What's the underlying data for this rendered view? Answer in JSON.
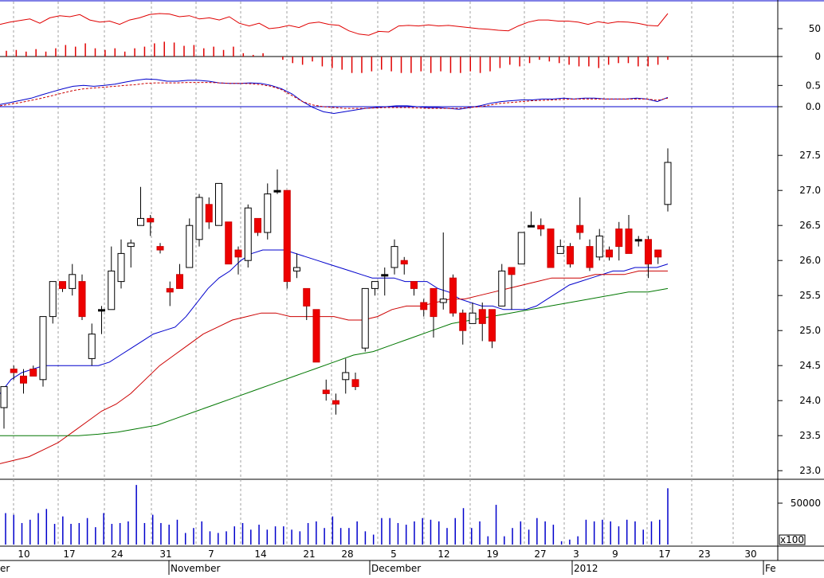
{
  "chart_data": [
    {
      "panel": "rsi",
      "type": "line",
      "y_range": [
        0,
        100
      ],
      "y_ticks": [
        "50"
      ],
      "series": [
        {
          "color": "#e00000",
          "values": [
            58,
            62,
            65,
            68,
            60,
            70,
            74,
            72,
            76,
            66,
            62,
            64,
            58,
            66,
            70,
            76,
            78,
            77,
            72,
            74,
            68,
            70,
            66,
            72,
            60,
            55,
            60,
            50,
            52,
            56,
            52,
            60,
            62,
            58,
            56,
            46,
            40,
            38,
            45,
            44,
            55,
            56,
            55,
            57,
            55,
            56,
            54,
            52,
            50,
            49,
            47,
            46,
            55,
            62,
            66,
            66,
            64,
            64,
            62,
            58,
            63,
            60,
            63,
            62,
            60,
            56,
            55,
            78
          ]
        }
      ]
    },
    {
      "panel": "rsi-histogram",
      "type": "bar",
      "y_range": [
        -30,
        30
      ],
      "y_ticks": [
        "0"
      ],
      "series": [
        {
          "color": "#e00000",
          "values": [
            7,
            8,
            6,
            9,
            6,
            10,
            14,
            12,
            16,
            10,
            8,
            10,
            6,
            10,
            12,
            16,
            18,
            17,
            13,
            14,
            10,
            12,
            8,
            12,
            4,
            2,
            4,
            0,
            -4,
            -8,
            -10,
            -6,
            -12,
            -14,
            -16,
            -20,
            -20,
            -18,
            -16,
            -18,
            -20,
            -20,
            -18,
            -20,
            -18,
            -20,
            -20,
            -18,
            -20,
            -18,
            -14,
            -10,
            -12,
            -8,
            -4,
            -6,
            -8,
            -10,
            -12,
            -12,
            -14,
            -10,
            -8,
            -8,
            -12,
            -12,
            -10,
            -4
          ]
        }
      ]
    },
    {
      "panel": "macd",
      "type": "line",
      "y_range": [
        -0.3,
        0.9
      ],
      "y_ticks": [
        "0.5",
        "0.0"
      ],
      "series": [
        {
          "color": "#0000cc",
          "values": [
            0.05,
            0.1,
            0.15,
            0.2,
            0.28,
            0.35,
            0.42,
            0.48,
            0.5,
            0.48,
            0.5,
            0.53,
            0.58,
            0.62,
            0.65,
            0.64,
            0.6,
            0.6,
            0.62,
            0.62,
            0.6,
            0.56,
            0.55,
            0.55,
            0.56,
            0.55,
            0.5,
            0.42,
            0.3,
            0.12,
            -0.02,
            -0.12,
            -0.16,
            -0.12,
            -0.08,
            -0.04,
            -0.02,
            0.0,
            0.02,
            0.02,
            0.0,
            -0.02,
            -0.02,
            -0.04,
            -0.06,
            -0.02,
            0.02,
            0.08,
            0.12,
            0.14,
            0.16,
            0.16,
            0.18,
            0.18,
            0.2,
            0.18,
            0.2,
            0.2,
            0.18,
            0.18,
            0.18,
            0.2,
            0.18,
            0.12,
            0.22
          ]
        },
        {
          "color": "#cc0000",
          "values": [
            0.02,
            0.06,
            0.1,
            0.15,
            0.2,
            0.26,
            0.32,
            0.38,
            0.42,
            0.44,
            0.46,
            0.48,
            0.5,
            0.52,
            0.55,
            0.56,
            0.56,
            0.56,
            0.57,
            0.57,
            0.57,
            0.56,
            0.55,
            0.55,
            0.54,
            0.52,
            0.48,
            0.4,
            0.26,
            0.12,
            0.04,
            0.0,
            -0.02,
            -0.04,
            -0.04,
            -0.04,
            -0.03,
            -0.02,
            -0.02,
            -0.02,
            -0.03,
            -0.04,
            -0.04,
            -0.04,
            -0.04,
            -0.02,
            0.0,
            0.04,
            0.08,
            0.1,
            0.12,
            0.14,
            0.15,
            0.16,
            0.17,
            0.18,
            0.18,
            0.18,
            0.18,
            0.18,
            0.18,
            0.18,
            0.18,
            0.15,
            0.2
          ]
        }
      ]
    },
    {
      "panel": "price",
      "type": "candlestick",
      "y_range": [
        22.9,
        27.9
      ],
      "y_ticks": [
        "27.5",
        "27.0",
        "26.5",
        "26.0",
        "25.5",
        "25.0",
        "24.5",
        "24.0",
        "23.5",
        "23.0"
      ],
      "candles": [
        [
          23.9,
          24.2,
          23.6,
          24.2
        ],
        [
          24.45,
          24.5,
          24.3,
          24.4
        ],
        [
          24.35,
          24.45,
          24.1,
          24.25
        ],
        [
          24.45,
          24.5,
          24.35,
          24.35
        ],
        [
          24.3,
          25.2,
          24.2,
          25.2
        ],
        [
          25.2,
          25.7,
          25.1,
          25.7
        ],
        [
          25.7,
          25.7,
          25.55,
          25.6
        ],
        [
          25.6,
          25.95,
          25.5,
          25.8
        ],
        [
          25.7,
          25.8,
          25.15,
          25.2
        ],
        [
          24.6,
          25.1,
          24.5,
          24.95
        ],
        [
          25.3,
          25.35,
          24.95,
          25.3
        ],
        [
          25.3,
          26.2,
          25.3,
          25.85
        ],
        [
          25.7,
          26.3,
          25.6,
          26.1
        ],
        [
          26.2,
          26.3,
          25.9,
          26.25
        ],
        [
          26.5,
          27.05,
          26.5,
          26.6
        ],
        [
          26.6,
          26.65,
          26.35,
          26.55
        ],
        [
          26.2,
          26.25,
          26.1,
          26.15
        ],
        [
          25.6,
          25.7,
          25.35,
          25.55
        ],
        [
          25.8,
          25.95,
          25.6,
          25.6
        ],
        [
          25.9,
          26.6,
          25.9,
          26.5
        ],
        [
          26.3,
          26.95,
          26.2,
          26.9
        ],
        [
          26.8,
          26.9,
          26.45,
          26.55
        ],
        [
          26.5,
          27.1,
          26.5,
          27.1
        ],
        [
          26.55,
          26.55,
          25.95,
          25.95
        ],
        [
          26.15,
          26.2,
          25.8,
          26.05
        ],
        [
          26.0,
          26.8,
          25.9,
          26.75
        ],
        [
          26.6,
          26.6,
          26.35,
          26.4
        ],
        [
          26.4,
          27.1,
          26.3,
          26.95
        ],
        [
          27.0,
          27.3,
          26.95,
          27.0
        ],
        [
          27.0,
          27.0,
          25.6,
          25.7
        ],
        [
          25.85,
          26.1,
          25.75,
          25.9
        ],
        [
          25.6,
          25.6,
          25.15,
          25.35
        ],
        [
          25.3,
          25.3,
          24.6,
          24.55
        ],
        [
          24.15,
          24.3,
          24.0,
          24.1
        ],
        [
          24.0,
          24.1,
          23.8,
          23.95
        ],
        [
          24.3,
          24.6,
          24.1,
          24.4
        ],
        [
          24.3,
          24.4,
          24.15,
          24.2
        ],
        [
          24.75,
          25.6,
          24.7,
          25.6
        ],
        [
          25.6,
          25.7,
          25.5,
          25.7
        ],
        [
          25.8,
          25.9,
          25.5,
          25.8
        ],
        [
          25.9,
          26.3,
          25.8,
          26.2
        ],
        [
          26.0,
          26.05,
          25.8,
          25.95
        ],
        [
          25.7,
          25.7,
          25.5,
          25.6
        ],
        [
          25.4,
          25.45,
          25.2,
          25.3
        ],
        [
          25.6,
          25.6,
          24.9,
          25.2
        ],
        [
          25.4,
          26.4,
          25.3,
          25.45
        ],
        [
          25.75,
          25.8,
          25.2,
          25.25
        ],
        [
          25.25,
          25.3,
          24.8,
          25.0
        ],
        [
          25.1,
          25.4,
          25.1,
          25.25
        ],
        [
          25.3,
          25.4,
          24.85,
          25.1
        ],
        [
          25.3,
          25.3,
          24.75,
          24.85
        ],
        [
          25.35,
          25.95,
          25.35,
          25.85
        ],
        [
          25.9,
          25.9,
          25.3,
          25.8
        ],
        [
          25.95,
          26.4,
          25.95,
          26.4
        ],
        [
          26.5,
          26.7,
          26.5,
          26.5
        ],
        [
          26.5,
          26.6,
          26.35,
          26.45
        ],
        [
          26.45,
          26.45,
          25.9,
          25.9
        ],
        [
          26.1,
          26.3,
          26.1,
          26.2
        ],
        [
          26.2,
          26.25,
          25.9,
          25.95
        ],
        [
          26.5,
          26.9,
          26.3,
          26.4
        ],
        [
          26.2,
          26.3,
          25.85,
          25.9
        ],
        [
          26.05,
          26.45,
          26.0,
          26.35
        ],
        [
          26.15,
          26.2,
          26.0,
          26.05
        ],
        [
          26.45,
          26.55,
          26.0,
          26.2
        ],
        [
          26.45,
          26.65,
          26.2,
          26.1
        ],
        [
          26.3,
          26.35,
          26.2,
          26.3
        ],
        [
          26.3,
          26.35,
          25.75,
          25.95
        ],
        [
          26.15,
          26.15,
          25.95,
          26.05
        ],
        [
          26.8,
          27.6,
          26.7,
          27.4
        ]
      ],
      "series": [
        {
          "color": "#0000cc",
          "values": [
            24.1,
            24.3,
            24.4,
            24.45,
            24.5,
            24.5,
            24.5,
            24.5,
            24.5,
            24.5,
            24.55,
            24.65,
            24.75,
            24.85,
            24.95,
            25.0,
            25.05,
            25.2,
            25.4,
            25.6,
            25.75,
            25.85,
            26.0,
            26.1,
            26.15,
            26.15,
            26.15,
            26.1,
            26.05,
            26.0,
            25.95,
            25.9,
            25.85,
            25.8,
            25.75,
            25.75,
            25.75,
            25.7,
            25.7,
            25.7,
            25.6,
            25.55,
            25.45,
            25.4,
            25.35,
            25.35,
            25.3,
            25.3,
            25.3,
            25.35,
            25.45,
            25.55,
            25.65,
            25.7,
            25.75,
            25.8,
            25.85,
            25.85,
            25.9,
            25.9,
            25.9,
            25.95
          ]
        },
        {
          "color": "#cc0000",
          "values": [
            23.1,
            23.15,
            23.2,
            23.3,
            23.4,
            23.55,
            23.7,
            23.85,
            23.95,
            24.1,
            24.3,
            24.5,
            24.65,
            24.8,
            24.95,
            25.05,
            25.15,
            25.2,
            25.25,
            25.25,
            25.2,
            25.2,
            25.2,
            25.2,
            25.15,
            25.15,
            25.2,
            25.3,
            25.35,
            25.35,
            25.4,
            25.45,
            25.45,
            25.5,
            25.55,
            25.6,
            25.65,
            25.7,
            25.75,
            25.75,
            25.75,
            25.8,
            25.8,
            25.8,
            25.85,
            25.85,
            25.85
          ]
        },
        {
          "color": "#007700",
          "values": [
            23.5,
            23.5,
            23.5,
            23.5,
            23.5,
            23.52,
            23.55,
            23.6,
            23.65,
            23.75,
            23.85,
            23.95,
            24.05,
            24.15,
            24.25,
            24.35,
            24.45,
            24.55,
            24.65,
            24.7,
            24.8,
            24.9,
            25.0,
            25.1,
            25.15,
            25.2,
            25.25,
            25.3,
            25.35,
            25.4,
            25.45,
            25.5,
            25.55,
            25.55,
            25.6
          ]
        }
      ]
    },
    {
      "panel": "volume",
      "type": "bar",
      "y_range": [
        0,
        75000
      ],
      "y_ticks": [
        "50000"
      ],
      "unit": "x100",
      "series": [
        {
          "color": "#0000cc",
          "values": [
            38000,
            36000,
            26000,
            30000,
            38000,
            43000,
            25000,
            34000,
            25000,
            26000,
            32000,
            21000,
            38000,
            25000,
            26000,
            28000,
            72000,
            26000,
            36000,
            26000,
            24000,
            30000,
            14000,
            20000,
            28000,
            16000,
            14000,
            16000,
            22000,
            26000,
            18000,
            24000,
            18000,
            22000,
            22000,
            18000,
            16000,
            26000,
            28000,
            20000,
            34000,
            20000,
            20000,
            28000,
            16000,
            12000,
            32000,
            32000,
            26000,
            24000,
            28000,
            32000,
            30000,
            28000,
            20000,
            32000,
            44000,
            20000,
            28000,
            10000,
            48000,
            10000,
            20000,
            28000,
            18000,
            32000,
            28000,
            24000,
            4000,
            6000,
            10000,
            30000,
            28000,
            30000,
            28000,
            22000,
            30000,
            28000,
            18000,
            28000,
            30000,
            68000
          ]
        }
      ]
    },
    {
      "panel": "x-axis",
      "type": "table",
      "day_labels": [
        "10",
        "17",
        "24",
        "31",
        "7",
        "14",
        "21",
        "28",
        "5",
        "12",
        "19",
        "27",
        "3",
        "9",
        "17",
        "23",
        "30"
      ],
      "month_labels": [
        "November",
        "December",
        "2012",
        "Fe"
      ]
    }
  ]
}
